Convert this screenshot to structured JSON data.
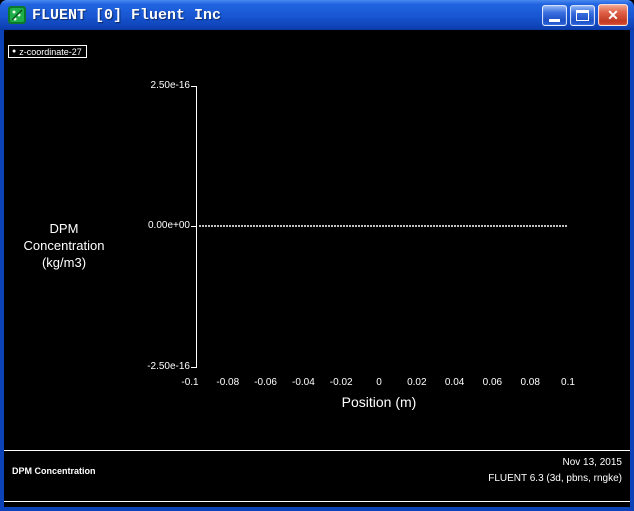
{
  "window": {
    "title": "FLUENT [0] Fluent Inc"
  },
  "icons": {
    "close": "✕",
    "legend_marker": "●"
  },
  "legend": {
    "label": "z-coordinate-27"
  },
  "chart_data": {
    "type": "scatter",
    "title": "DPM Concentration",
    "xlabel": "Position (m)",
    "ylabel": "DPM Concentration (kg/m3)",
    "ylabel_lines": [
      "DPM",
      "Concentration",
      "(kg/m3)"
    ],
    "xlim": [
      -0.1,
      0.1
    ],
    "ylim": [
      -2.5e-16,
      2.5e-16
    ],
    "x_ticks": [
      "-0.1",
      "-0.08",
      "-0.06",
      "-0.04",
      "-0.02",
      "0",
      "0.02",
      "0.04",
      "0.06",
      "0.08",
      "0.1"
    ],
    "y_ticks": [
      "2.50e-16",
      "0.00e+00",
      "-2.50e-16"
    ],
    "grid": false,
    "legend_position": "top-left",
    "series": [
      {
        "name": "z-coordinate-27",
        "marker": "dot",
        "color": "#ffffff",
        "x_start": -0.095,
        "x_end": 0.099,
        "y_value": 0
      }
    ]
  },
  "footer": {
    "title": "DPM Concentration",
    "date": "Nov 13, 2015",
    "version": "FLUENT 6.3 (3d, pbns, rngke)"
  },
  "colors": {
    "background": "#000000",
    "foreground": "#ffffff",
    "titlebar_blue": "#1856d2",
    "close_red": "#c23a22"
  }
}
